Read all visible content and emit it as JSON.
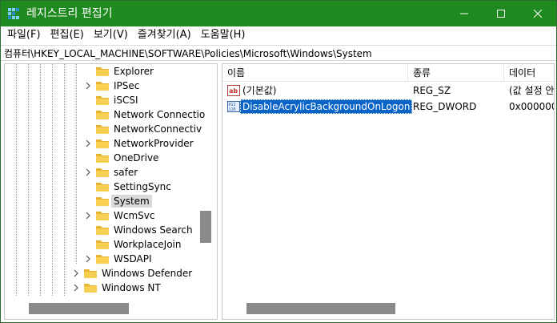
{
  "window": {
    "title": "레지스트리 편집기",
    "accent_color": "#1f8a1f"
  },
  "menu": {
    "items": [
      "파일(F)",
      "편집(E)",
      "보기(V)",
      "즐겨찾기(A)",
      "도움말(H)"
    ]
  },
  "address": {
    "path": "컴퓨터\\HKEY_LOCAL_MACHINE\\SOFTWARE\\Policies\\Microsoft\\Windows\\System"
  },
  "tree": {
    "items": [
      {
        "label": "Explorer",
        "expandable": false,
        "selected": false
      },
      {
        "label": "IPSec",
        "expandable": true,
        "selected": false
      },
      {
        "label": "iSCSI",
        "expandable": false,
        "selected": false
      },
      {
        "label": "Network Connectio",
        "expandable": false,
        "selected": false
      },
      {
        "label": "NetworkConnectiv",
        "expandable": false,
        "selected": false
      },
      {
        "label": "NetworkProvider",
        "expandable": true,
        "selected": false
      },
      {
        "label": "OneDrive",
        "expandable": false,
        "selected": false
      },
      {
        "label": "safer",
        "expandable": true,
        "selected": false
      },
      {
        "label": "SettingSync",
        "expandable": false,
        "selected": false
      },
      {
        "label": "System",
        "expandable": false,
        "selected": true
      },
      {
        "label": "WcmSvc",
        "expandable": true,
        "selected": false
      },
      {
        "label": "Windows Search",
        "expandable": false,
        "selected": false
      },
      {
        "label": "WorkplaceJoin",
        "expandable": false,
        "selected": false
      },
      {
        "label": "WSDAPI",
        "expandable": true,
        "selected": false
      },
      {
        "label": "Windows Defender",
        "expandable": true,
        "selected": false
      },
      {
        "label": "Windows NT",
        "expandable": true,
        "selected": false
      }
    ]
  },
  "list": {
    "columns": [
      "이름",
      "종류",
      "데이터"
    ],
    "rows": [
      {
        "icon": "string-value-icon",
        "name": "(기본값)",
        "type": "REG_SZ",
        "data": "(값 설정 안",
        "selected": false
      },
      {
        "icon": "dword-value-icon",
        "name": "DisableAcrylicBackgroundOnLogon",
        "type": "REG_DWORD",
        "data": "0x0000000",
        "selected": true
      }
    ]
  }
}
